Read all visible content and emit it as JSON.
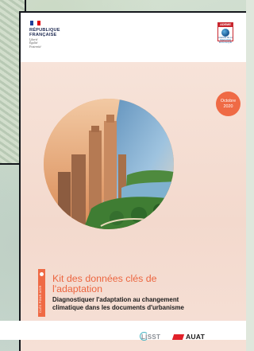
{
  "header": {
    "republic_lines": [
      "RÉPUBLIQUE",
      "FRANÇAISE"
    ],
    "motto_lines": [
      "Liberté",
      "Égalité",
      "Fraternité"
    ],
    "ademe_label": "ADEME",
    "ademe_sub": "AGENCE DE LA TRANSITION ÉCOLOGIQUE"
  },
  "badge": {
    "line1": "Octobre",
    "line2": "2020"
  },
  "side_label": "CLÉS POUR AGIR",
  "title_lines": [
    "Kit des données clés de",
    "l'adaptation"
  ],
  "subtitle_lines": [
    "Diagnostiquer l'adaptation au changement",
    "climatique dans les documents d'urbanisme"
  ],
  "footer": {
    "logo1": "LISST",
    "logo2": "AUAT"
  },
  "colors": {
    "accent": "#ef6a45",
    "title": "#ec6640",
    "peach": "#f5ded3",
    "frame": "#14171c"
  }
}
